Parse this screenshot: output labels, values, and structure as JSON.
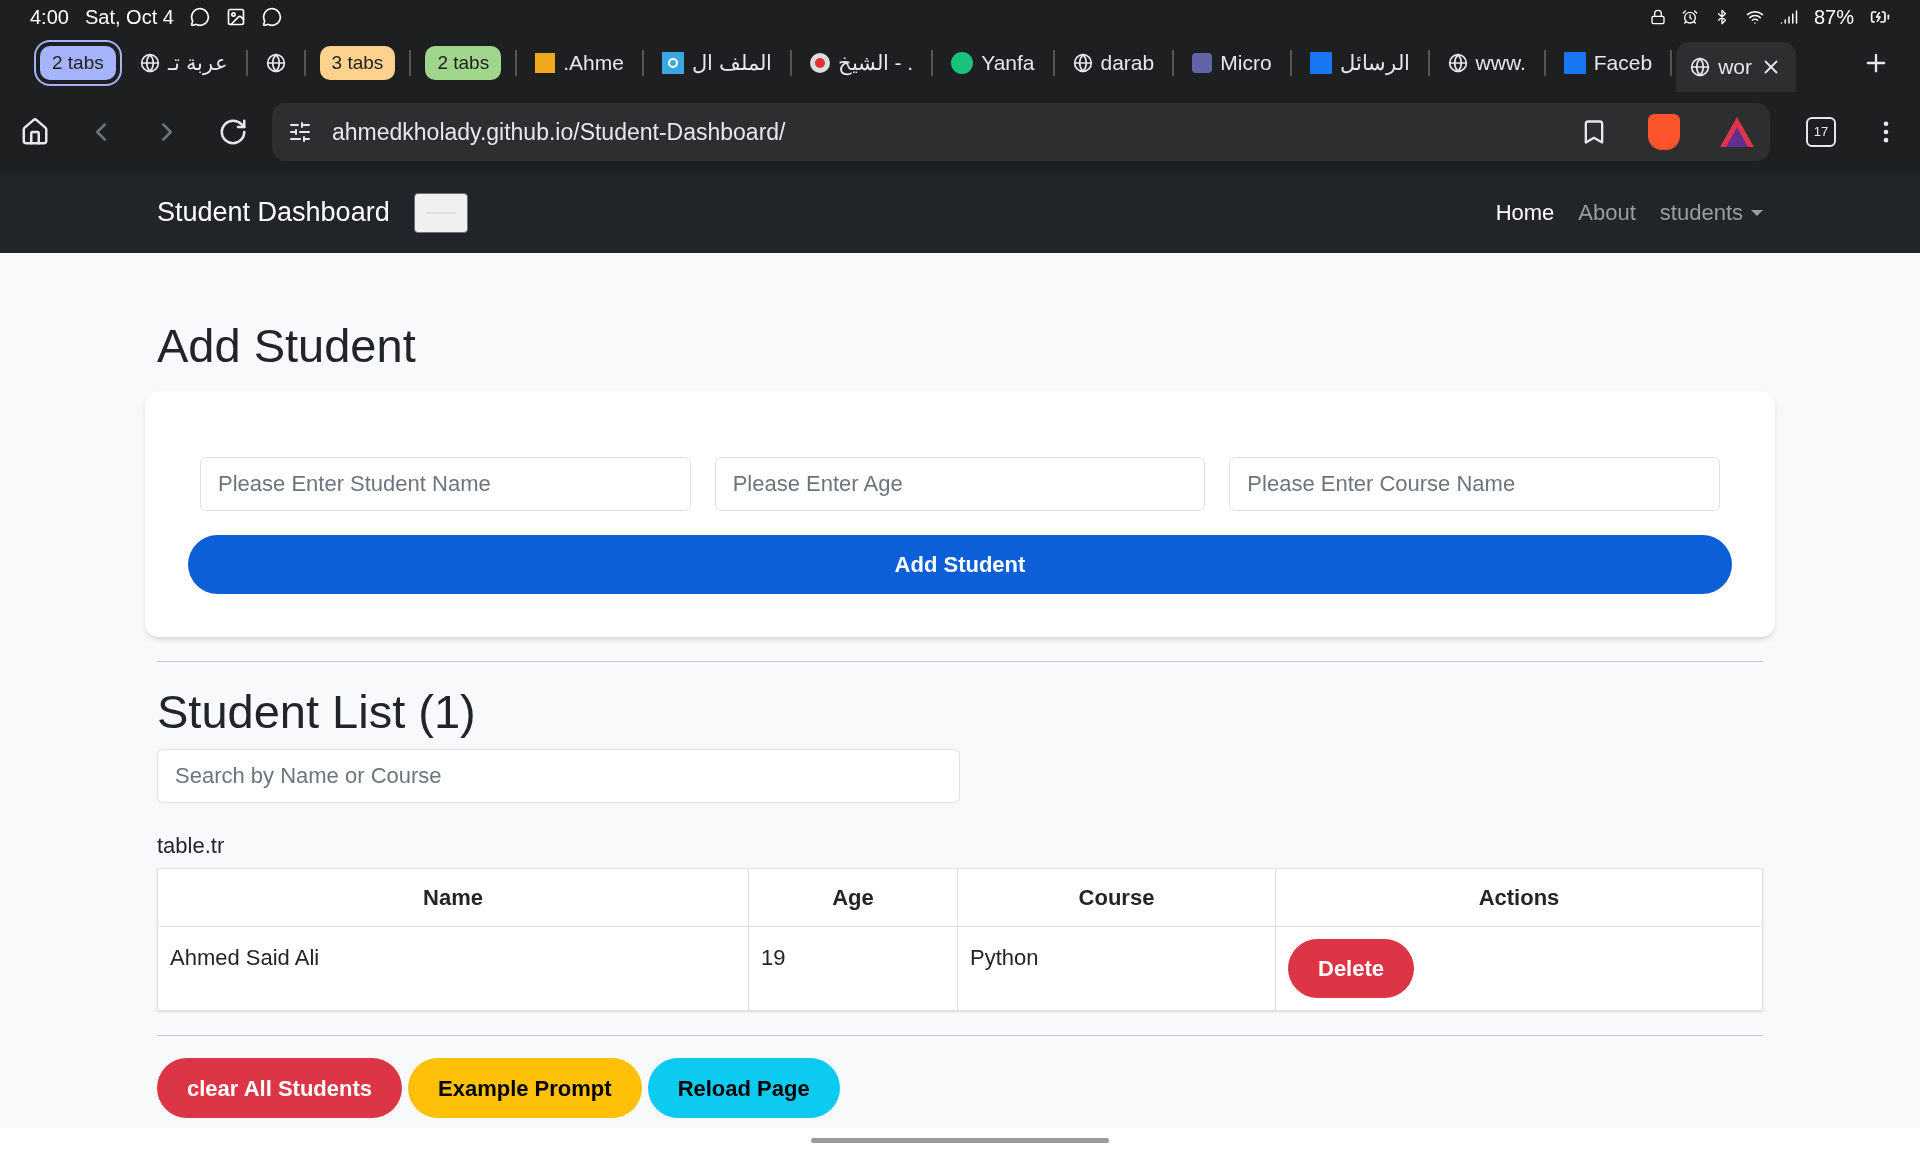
{
  "status_bar": {
    "time": "4:00",
    "date": "Sat, Oct 4",
    "battery": "87%"
  },
  "browser_tabs": [
    {
      "kind": "group",
      "label": "2 tabs",
      "color": "#a5b4fc",
      "selected": true
    },
    {
      "kind": "site",
      "label": "عربة تـ",
      "selected": false
    },
    {
      "kind": "site",
      "selected": false
    },
    {
      "kind": "group",
      "label": "3 tabs",
      "color": "#fcd28d",
      "selected": false
    },
    {
      "kind": "group",
      "label": "2 tabs",
      "color": "#9fd68c",
      "selected": false
    },
    {
      "kind": "site",
      "label": ".Ahme",
      "selected": false
    },
    {
      "kind": "site",
      "label": "الملف ال",
      "selected": false
    },
    {
      "kind": "site",
      "label": "الشيخ - .",
      "selected": false
    },
    {
      "kind": "site",
      "label": "Yanfa",
      "selected": false
    },
    {
      "kind": "site",
      "label": "darab",
      "selected": false
    },
    {
      "kind": "site",
      "label": "Micro",
      "selected": false
    },
    {
      "kind": "site",
      "label": "الرسائل",
      "selected": false
    },
    {
      "kind": "site",
      "label": "www.",
      "selected": false
    },
    {
      "kind": "site",
      "label": "Faceb",
      "selected": false
    },
    {
      "kind": "site",
      "label": "wor",
      "selected": true
    }
  ],
  "address_bar": {
    "url": "ahmedkholady.github.io/Student-Dashboard/",
    "tab_count": "17"
  },
  "navbar": {
    "brand": "Student Dashboard",
    "links": [
      {
        "label": "Home",
        "selected": true,
        "dropdown": false
      },
      {
        "label": "About",
        "selected": false,
        "dropdown": false
      },
      {
        "label": "students",
        "selected": false,
        "dropdown": true
      }
    ]
  },
  "add_form": {
    "title": "Add Student",
    "fields": [
      {
        "placeholder": "Please Enter Student Name"
      },
      {
        "placeholder": "Please Enter Age"
      },
      {
        "placeholder": "Please Enter Course Name"
      }
    ],
    "button": "Add Student"
  },
  "student_list": {
    "title": "Student List (1)",
    "search": {
      "placeholder": "Search by Name or Course"
    },
    "caption": "table.tr",
    "table": {
      "columns": [
        "Name",
        "Age",
        "Course",
        "Actions"
      ],
      "rows": [
        {
          "name": "Ahmed Said Ali",
          "age": "19",
          "course": "Python",
          "action": "Delete"
        }
      ]
    }
  },
  "footer_buttons": [
    {
      "label": "clear All Students",
      "kind": "danger"
    },
    {
      "label": "Example Prompt",
      "kind": "warning"
    },
    {
      "label": "Reload Page",
      "kind": "info"
    }
  ]
}
